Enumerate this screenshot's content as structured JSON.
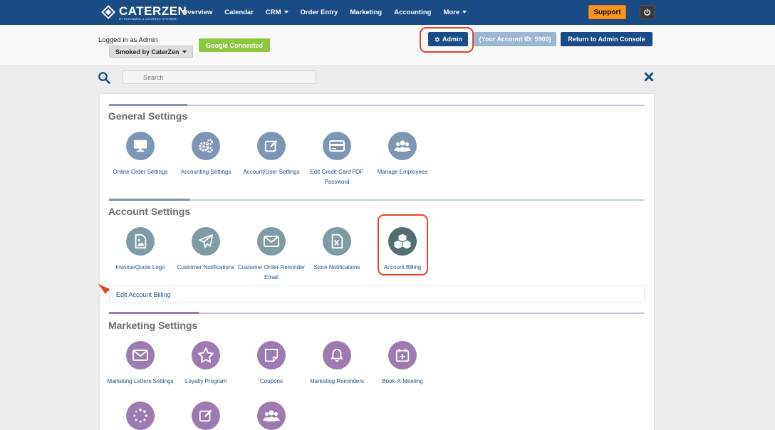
{
  "nav": {
    "logo_name": "CATERZEN",
    "logo_tagline": "BY ECHOWAVE & CATERING SYSTEMS",
    "items": [
      {
        "label": "Overview",
        "dropdown": false
      },
      {
        "label": "Calendar",
        "dropdown": false
      },
      {
        "label": "CRM",
        "dropdown": true
      },
      {
        "label": "Order Entry",
        "dropdown": false
      },
      {
        "label": "Marketing",
        "dropdown": false
      },
      {
        "label": "Accounting",
        "dropdown": false
      },
      {
        "label": "More",
        "dropdown": true
      }
    ],
    "support_label": "Support",
    "power_icon": "power-icon"
  },
  "subheader": {
    "logged_in_text": "Logged in as Admin",
    "account_selector": "Smoked by CaterZen",
    "google_label": "Google Connected",
    "admin_label": "Admin",
    "account_id_label": "(Your Account ID: 5900)",
    "return_label": "Return to Admin Console"
  },
  "search": {
    "placeholder": "Search"
  },
  "sections": {
    "general": {
      "title": "General Settings",
      "tiles": [
        {
          "label": "Online Order Settings",
          "icon": "monitor-icon"
        },
        {
          "label": "Accounting Settings",
          "icon": "gears-icon"
        },
        {
          "label": "Account/User Settings",
          "icon": "edit-icon"
        },
        {
          "label": "Edit Credit Card PDF Password",
          "icon": "credit-card-icon"
        },
        {
          "label": "Manage Employees",
          "icon": "users-icon"
        }
      ]
    },
    "account": {
      "title": "Account Settings",
      "tiles": [
        {
          "label": "Invoice/Quote Logo",
          "icon": "image-file-icon"
        },
        {
          "label": "Customer Notifications",
          "icon": "paper-plane-icon"
        },
        {
          "label": "Customer Order Reminder Email",
          "icon": "envelope-icon"
        },
        {
          "label": "Store Notifications",
          "icon": "excel-file-icon"
        },
        {
          "label": "Account Billing",
          "icon": "cubes-icon"
        }
      ],
      "edit_link": "Edit Account Billing"
    },
    "marketing": {
      "title": "Marketing Settings",
      "tiles": [
        {
          "label": "Marketing Letters Settings",
          "icon": "envelope-icon"
        },
        {
          "label": "Loyalty Program",
          "icon": "star-icon"
        },
        {
          "label": "Coupons",
          "icon": "sticky-note-icon"
        },
        {
          "label": "Marketing Reminders",
          "icon": "bell-icon"
        },
        {
          "label": "Book-A-Meeting",
          "icon": "calendar-plus-icon"
        }
      ],
      "row2_icons": [
        "spinner-icon",
        "edit-icon",
        "users-icon"
      ]
    }
  },
  "colors": {
    "nav_bg": "#1a4b85",
    "support": "#f7931e",
    "google": "#8dc63f",
    "highlight": "#e0452d",
    "general_circle": "#7c97b6",
    "account_circle": "#7e9ca3",
    "marketing_circle": "#9c7ab2"
  }
}
